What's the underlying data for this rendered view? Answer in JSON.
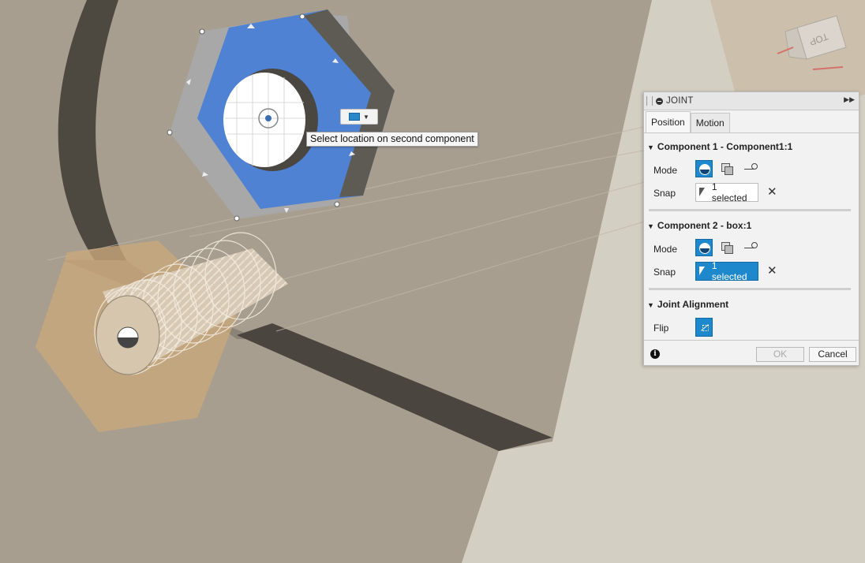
{
  "viewport": {
    "tooltip_text": "Select location on second component",
    "viewcube_label": "TOP"
  },
  "joint_panel": {
    "title": "JOINT",
    "tabs": [
      {
        "label": "Position",
        "active": true
      },
      {
        "label": "Motion",
        "active": false
      }
    ],
    "component1": {
      "title": "Component 1 - Component1:1",
      "mode_label": "Mode",
      "snap_label": "Snap",
      "snap_value": "1 selected"
    },
    "component2": {
      "title": "Component 2 - box:1",
      "mode_label": "Mode",
      "snap_label": "Snap",
      "snap_value": "1 selected"
    },
    "alignment": {
      "title": "Joint Alignment",
      "flip_label": "Flip"
    },
    "ok_label": "OK",
    "cancel_label": "Cancel",
    "clear_symbol": "✕"
  },
  "colors": {
    "accent": "#1e88cc",
    "face_blue": "#4f82d2",
    "body_tan": "#a59d90"
  },
  "icons": [
    "info-icon",
    "cursor-icon",
    "flip-icon",
    "half-circle-icon",
    "viewcube-icon"
  ]
}
